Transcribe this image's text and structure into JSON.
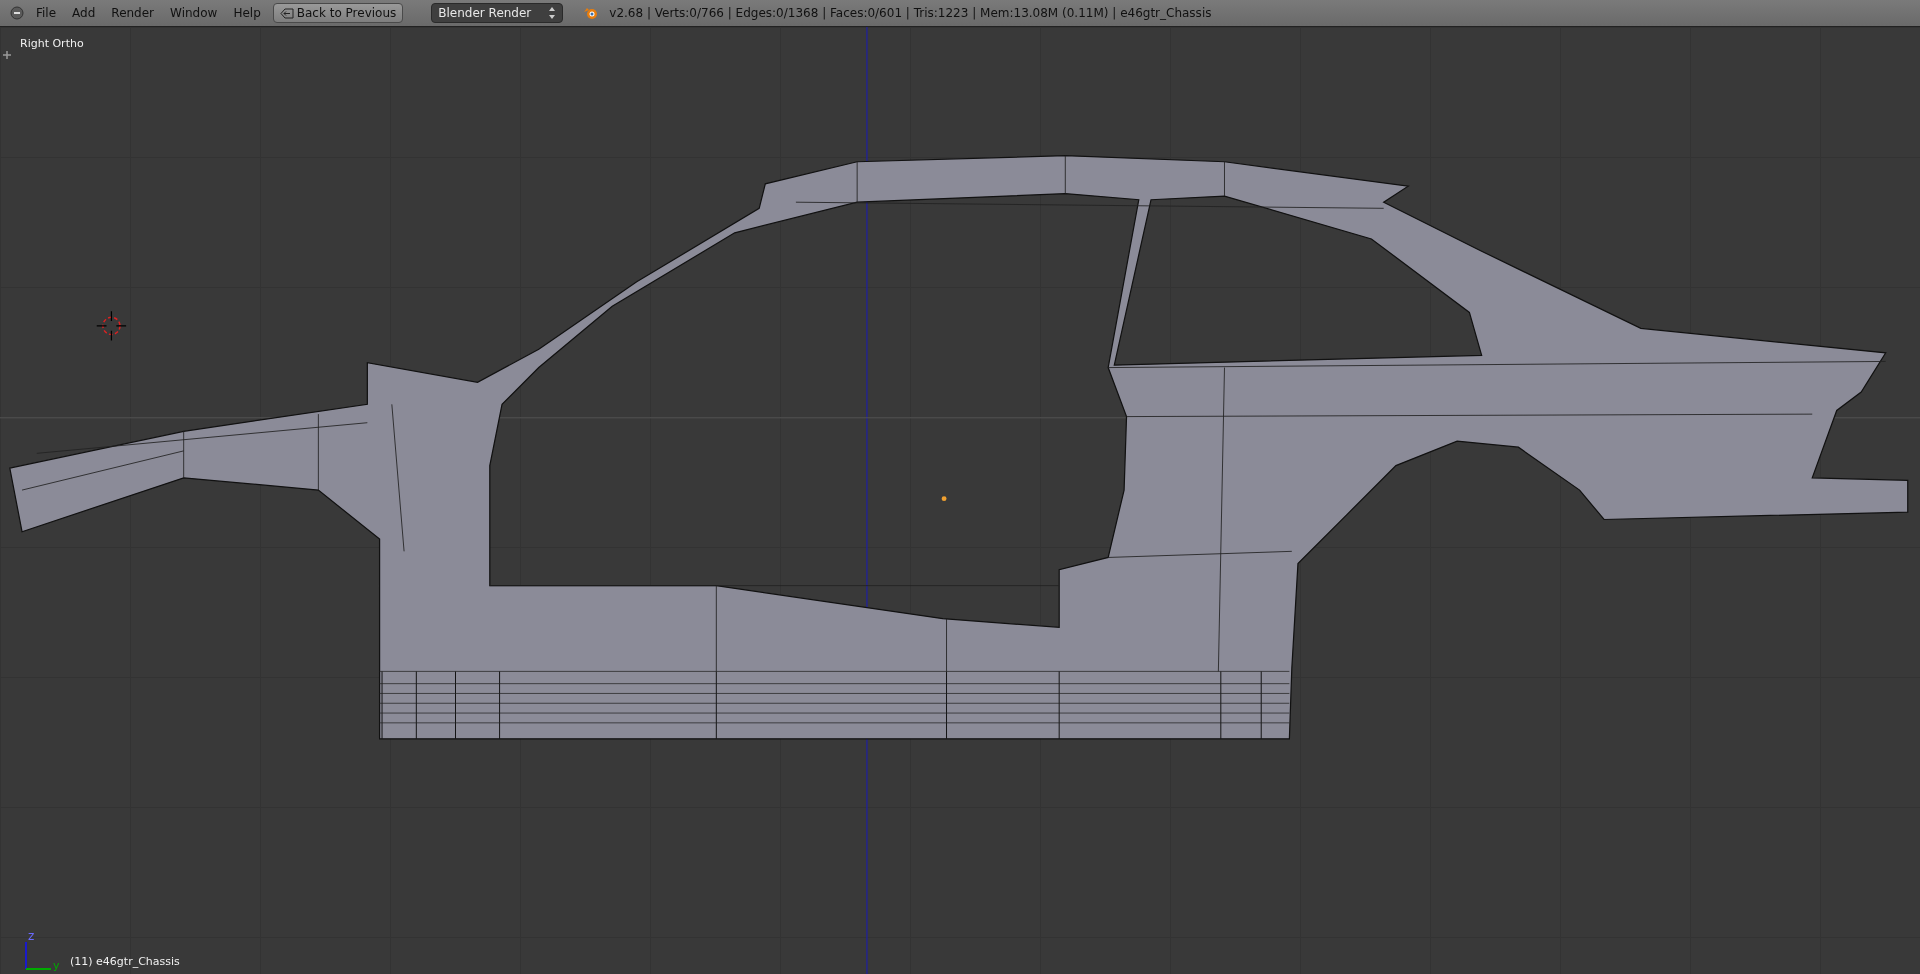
{
  "header": {
    "menus": [
      "File",
      "Add",
      "Render",
      "Window",
      "Help"
    ],
    "back_button": "Back to Previous",
    "render_engine": "Blender Render",
    "stats": "v2.68 | Verts:0/766 | Edges:0/1368 | Faces:0/601 | Tris:1223 | Mem:13.08M (0.11M) | e46gtr_Chassis"
  },
  "viewport": {
    "view_label": "Right Ortho",
    "axis_labels": [
      "z",
      "y"
    ],
    "object_label": "(11) e46gtr_Chassis"
  }
}
